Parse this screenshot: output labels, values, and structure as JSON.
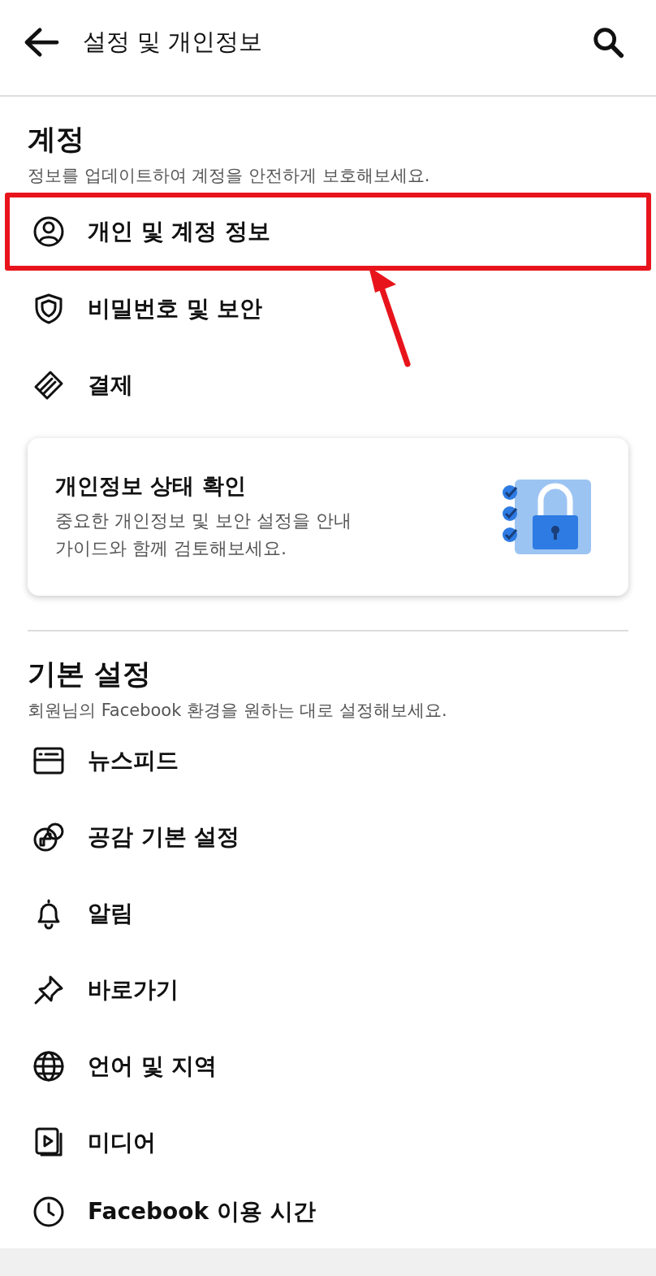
{
  "header": {
    "title": "설정 및 개인정보"
  },
  "sections": [
    {
      "title": "계정",
      "subtitle": "정보를 업데이트하여 계정을 안전하게 보호해보세요.",
      "items": [
        {
          "label": "개인 및 계정 정보",
          "highlighted": true
        },
        {
          "label": "비밀번호 및 보안",
          "highlighted": false
        },
        {
          "label": "결제",
          "highlighted": false
        }
      ],
      "card": {
        "title": "개인정보 상태 확인",
        "description": "중요한 개인정보 및 보안 설정을 안내\n가이드와 함께 검토해보세요."
      }
    },
    {
      "title": "기본 설정",
      "subtitle": "회원님의 Facebook 환경을 원하는 대로 설정해보세요.",
      "items": [
        {
          "label": "뉴스피드",
          "highlighted": false
        },
        {
          "label": "공감 기본 설정",
          "highlighted": false
        },
        {
          "label": "알림",
          "highlighted": false
        },
        {
          "label": "바로가기",
          "highlighted": false
        },
        {
          "label": "언어 및 지역",
          "highlighted": false
        },
        {
          "label": "미디어",
          "highlighted": false
        },
        {
          "label": "Facebook 이용 시간",
          "highlighted": false
        }
      ]
    }
  ]
}
